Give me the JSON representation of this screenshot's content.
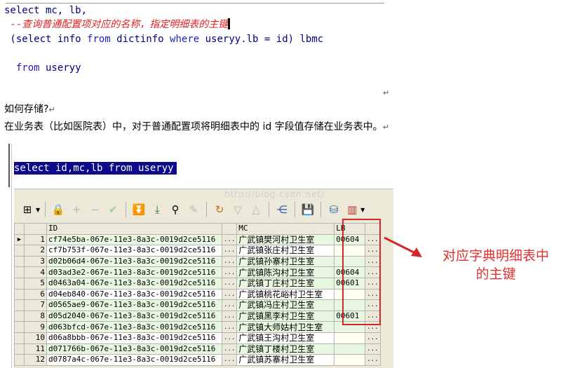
{
  "code_top": {
    "line1": "select mc, lb,",
    "line2_comment": " --查询普通配置项对应的名称，指定明细表的主键",
    "line3_a": " (select info ",
    "line3_from": "from",
    "line3_b": " dictinfo ",
    "line3_where": "where",
    "line3_c": " useryy.lb = id) lbmc",
    "line4_from": "from",
    "line4_b": " useryy"
  },
  "doc": {
    "return_mark": "↵",
    "heading": "如何存储?",
    "paragraph": "在业务表（比如医院表）中，对于普通配置项将明细表中的 id 字段值存储在业务表中。"
  },
  "editor": {
    "selected_sql": "select id,mc,lb from useryy",
    "watermark": "http://blog.csdn.net/"
  },
  "toolbar": {
    "icons": [
      "grid-icon",
      "lock-icon",
      "plus-icon",
      "minus-icon",
      "check-icon",
      "down-arrow-icon",
      "down-arrow-underlined-icon",
      "binoculars-icon",
      "clear-icon",
      "refresh-icon",
      "filter-icon",
      "up-icon",
      "tree-icon",
      "save-icon",
      "database-icon",
      "chart-icon"
    ]
  },
  "grid": {
    "columns": [
      "ID",
      "MC",
      "LB"
    ],
    "rows": [
      {
        "num": "1",
        "id": "cf74e5ba-067e-11e3-8a3c-0019d2ce5116",
        "mc": "广武镇樊河村卫生室",
        "lb": "00604"
      },
      {
        "num": "2",
        "id": "cf7b753f-067e-11e3-8a3c-0019d2ce5116",
        "mc": "广武镇张庄村卫生室",
        "lb": ""
      },
      {
        "num": "3",
        "id": "d02b06d4-067e-11e3-8a3c-0019d2ce5116",
        "mc": "广武镇孙寨村卫生室",
        "lb": ""
      },
      {
        "num": "4",
        "id": "d03ad3e2-067e-11e3-8a3c-0019d2ce5116",
        "mc": "广武镇陈沟村卫生室",
        "lb": "00604"
      },
      {
        "num": "5",
        "id": "d0463a04-067e-11e3-8a3c-0019d2ce5116",
        "mc": "广武镇丁庄村卫生室",
        "lb": "00601"
      },
      {
        "num": "6",
        "id": "d04eb840-067e-11e3-8a3c-0019d2ce5116",
        "mc": "广武镇桃花峪村卫生室",
        "lb": ""
      },
      {
        "num": "7",
        "id": "d0565ae9-067e-11e3-8a3c-0019d2ce5116",
        "mc": "广武镇冯庄村卫生室",
        "lb": ""
      },
      {
        "num": "8",
        "id": "d05d2040-067e-11e3-8a3c-0019d2ce5116",
        "mc": "广武镇黑李村卫生室",
        "lb": "00601"
      },
      {
        "num": "9",
        "id": "d063bfcd-067e-11e3-8a3c-0019d2ce5116",
        "mc": "广武镇大师姑村卫生室",
        "lb": ""
      },
      {
        "num": "10",
        "id": "d06a8bbb-067e-11e3-8a3c-0019d2ce5116",
        "mc": "广武镇王沟村卫生室",
        "lb": ""
      },
      {
        "num": "11",
        "id": "d071766b-067e-11e3-8a3c-0019d2ce5116",
        "mc": "广武镇丁楼村卫生室",
        "lb": ""
      },
      {
        "num": "12",
        "id": "d0787a4c-067e-11e3-8a3c-0019d2ce5116",
        "mc": "广武镇苏寨村卫生室",
        "lb": ""
      }
    ],
    "cell_button": "...",
    "row_indicator": "▶"
  },
  "annotation": {
    "line1": "对应字典明细表中",
    "line2": "的主键",
    "color": "#e03030"
  },
  "colors": {
    "selection": "#0a0a8a",
    "keyword": "#1f1fbf",
    "comment": "#e02020"
  }
}
